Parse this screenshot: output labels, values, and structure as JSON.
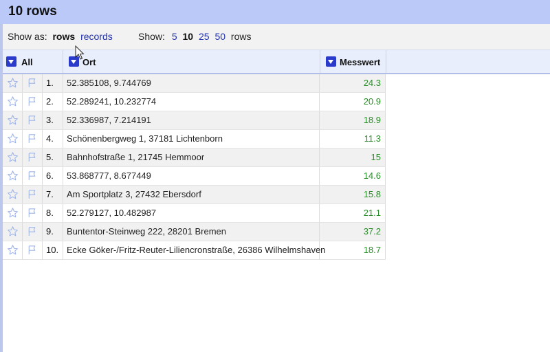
{
  "title": "10 rows",
  "controls": {
    "show_as_label": "Show as:",
    "mode_rows": "rows",
    "mode_records": "records",
    "show_label": "Show:",
    "page_sizes": [
      "5",
      "10",
      "25",
      "50"
    ],
    "current_page_size": "10",
    "rows_suffix": "rows"
  },
  "columns": {
    "all": "All",
    "ort": "Ort",
    "messwert": "Messwert"
  },
  "rows": [
    {
      "idx": "1.",
      "ort": "52.385108, 9.744769",
      "messwert": "24.3"
    },
    {
      "idx": "2.",
      "ort": "52.289241, 10.232774",
      "messwert": "20.9"
    },
    {
      "idx": "3.",
      "ort": "52.336987, 7.214191",
      "messwert": "18.9"
    },
    {
      "idx": "4.",
      "ort": "Schönenbergweg 1, 37181 Lichtenborn",
      "messwert": "11.3"
    },
    {
      "idx": "5.",
      "ort": "Bahnhofstraße 1, 21745 Hemmoor",
      "messwert": "15"
    },
    {
      "idx": "6.",
      "ort": "53.868777, 8.677449",
      "messwert": "14.6"
    },
    {
      "idx": "7.",
      "ort": "Am Sportplatz 3, 27432 Ebersdorf",
      "messwert": "15.8"
    },
    {
      "idx": "8.",
      "ort": "52.279127, 10.482987",
      "messwert": "21.1"
    },
    {
      "idx": "9.",
      "ort": "Buntentor-Steinweg 222, 28201 Bremen",
      "messwert": "37.2"
    },
    {
      "idx": "10.",
      "ort": "Ecke Göker-/Fritz-Reuter-Liliencronstraße, 26386 Wilhelmshaven",
      "messwert": "18.7"
    }
  ],
  "colors": {
    "title_bar": "#bac9f8",
    "link": "#2233aa",
    "value_text": "#2a8a2a",
    "dropdown_button": "#2a3bcc"
  },
  "icons": {
    "row_star": "star-icon",
    "row_flag": "flag-icon",
    "column_menu": "dropdown-arrow-icon",
    "pointer": "mouse-cursor-icon"
  }
}
